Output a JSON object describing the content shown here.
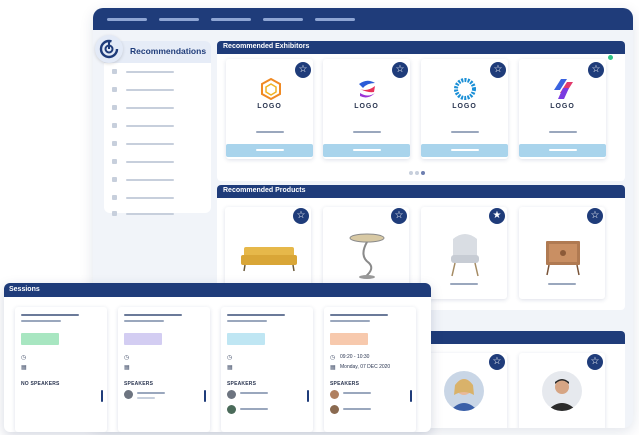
{
  "sidebar": {
    "title": "Recommendations",
    "item_count": 9
  },
  "exhibitors": {
    "header": "Recommended Exhibitors",
    "cards": [
      {
        "logo_text": "LOGO",
        "logo": "hexagon-logo",
        "online": false
      },
      {
        "logo_text": "LOGO",
        "logo": "swoosh-logo",
        "online": false
      },
      {
        "logo_text": "LOGO",
        "logo": "sun-logo",
        "online": false
      },
      {
        "logo_text": "LOGO",
        "logo": "parallelogram-logo",
        "online": true
      }
    ]
  },
  "products": {
    "header": "Recommended Products",
    "items": [
      {
        "image": "sofa-image",
        "favorite": false
      },
      {
        "image": "side-table-image",
        "favorite": false
      },
      {
        "image": "armchair-image",
        "favorite": true
      },
      {
        "image": "cabinet-image",
        "favorite": false
      }
    ]
  },
  "sessions": {
    "header": "Sessions",
    "cards": [
      {
        "tag_color": "#a8e6c1",
        "speakers_label": "NO SPEAKERS",
        "time": "",
        "date": "",
        "speakers": 0
      },
      {
        "tag_color": "#d3cdf2",
        "speakers_label": "SPEAKERS",
        "time": "",
        "date": "",
        "speakers": 1
      },
      {
        "tag_color": "#bfe6f3",
        "speakers_label": "SPEAKERS",
        "time": "",
        "date": "",
        "speakers": 2
      },
      {
        "tag_color": "#f7c9ad",
        "speakers_label": "SPEAKERS",
        "time": "09:20 - 10:30",
        "date": "Monday, 07 DEC 2020",
        "speakers": 2
      }
    ]
  },
  "colors": {
    "primary": "#1f3c7a",
    "accent_light": "#a9d4ec",
    "online": "#2ec486"
  }
}
